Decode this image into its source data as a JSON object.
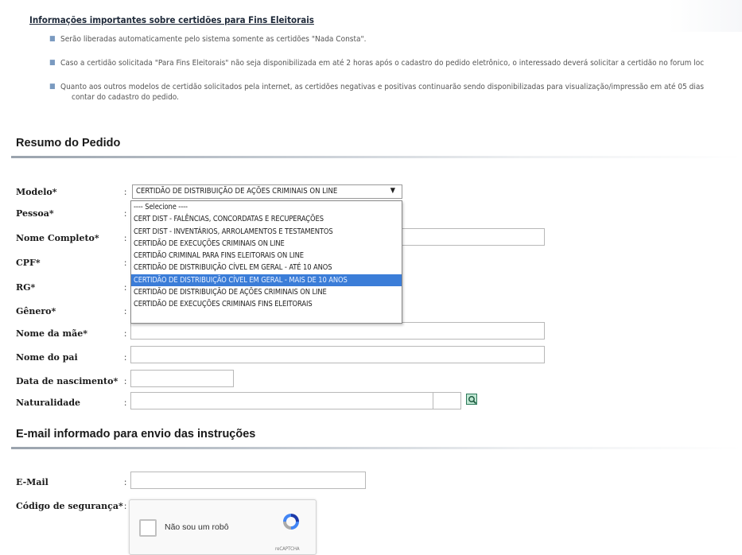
{
  "info": {
    "title": "Informações importantes sobre certidões para Fins Eleitorais",
    "bullets": [
      "Serão liberadas automaticamente pelo sistema somente as certidões \"Nada Consta\".",
      "Caso a certidão solicitada \"Para Fins Eleitorais\" não seja disponibilizada em até 2 horas após o cadastro do pedido eletrônico, o interessado deverá solicitar a certidão no forum loc",
      "Quanto aos outros modelos de certidão solicitados pela internet, as certidões negativas e positivas continuarão sendo disponibilizadas para visualização/impressão em até 05 dias",
      "contar do cadastro do pedido."
    ]
  },
  "resumo": {
    "title": "Resumo do Pedido",
    "labels": {
      "modelo": "Modelo*",
      "pessoa": "Pessoa*",
      "nome_completo": "Nome Completo*",
      "cpf": "CPF*",
      "rg": "RG*",
      "genero": "Gênero*",
      "nome_mae": "Nome da mãe*",
      "nome_pai": "Nome do pai",
      "data_nascimento": "Data de nascimento*",
      "naturalidade": "Naturalidade"
    },
    "colon": ":",
    "modelo_selected": "CERTIDÃO DE DISTRIBUIÇÃO DE AÇÕES CRIMINAIS ON LINE",
    "modelo_options": [
      "---- Selecione ----",
      "CERT DIST - FALÊNCIAS, CONCORDATAS E RECUPERAÇÕES",
      "CERT DIST - INVENTÁRIOS, ARROLAMENTOS E TESTAMENTOS",
      "CERTIDÃO DE EXECUÇÕES CRIMINAIS ON LINE",
      "CERTIDÃO CRIMINAL PARA FINS ELEITORAIS ON LINE",
      "CERTIDÃO DE DISTRIBUIÇÃO CÍVEL EM GERAL - ATÉ 10 ANOS",
      "CERTIDÃO DE DISTRIBUIÇÃO CÍVEL EM GERAL - MAIS DE 10 ANOS",
      "CERTIDÃO DE DISTRIBUIÇÃO DE AÇÕES CRIMINAIS ON LINE",
      "CERTIDÃO DE EXECUÇÕES CRIMINAIS FINS ELEITORAIS"
    ],
    "highlighted_option_index": 6
  },
  "email": {
    "title": "E-mail informado para envio das instruções",
    "label_email": "E-Mail",
    "label_codigo": "Código de segurança*",
    "captcha_text": "Não sou um robô",
    "captcha_brand": "reCAPTCHA"
  },
  "colors": {
    "highlight": "#3b7dd8",
    "bullet": "#7a9ac0"
  }
}
